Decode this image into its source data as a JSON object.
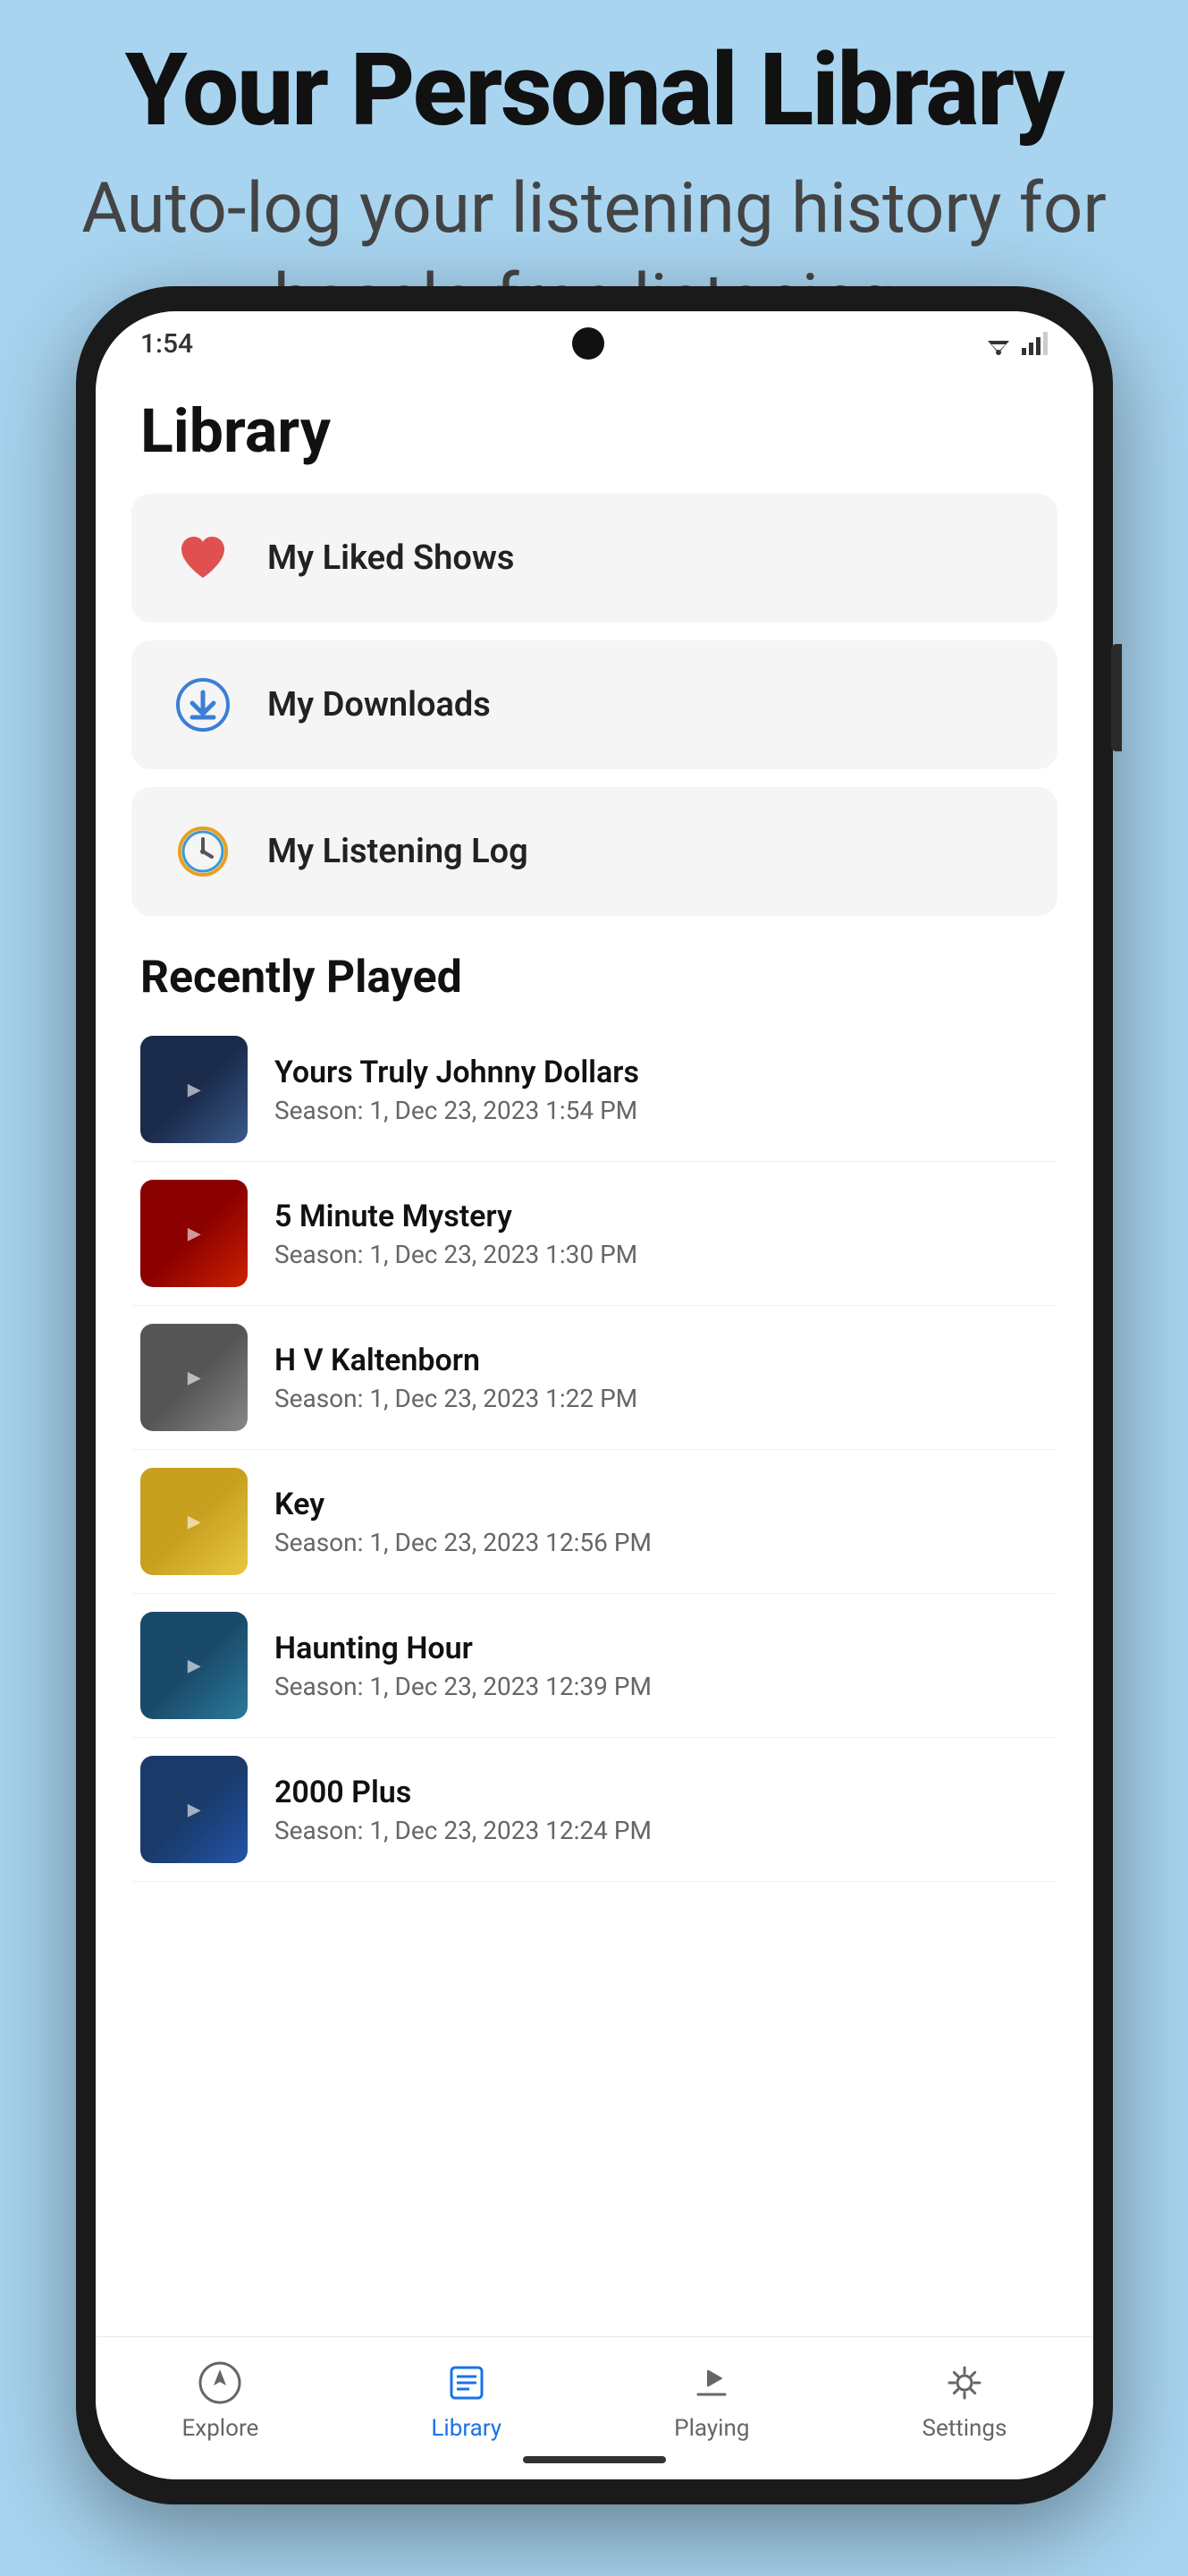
{
  "background": {
    "title": "Your Personal Library",
    "subtitle": "Auto-log your listening history  for hassle-free listening."
  },
  "status_bar": {
    "time": "1:54",
    "wifi": "▲",
    "signal": "▲"
  },
  "page_title": "Library",
  "library_items": [
    {
      "id": "liked-shows",
      "label": "My Liked Shows",
      "icon": "heart"
    },
    {
      "id": "downloads",
      "label": "My Downloads",
      "icon": "download"
    },
    {
      "id": "listening-log",
      "label": "My Listening Log",
      "icon": "clock"
    }
  ],
  "recently_played": {
    "section_title": "Recently Played",
    "items": [
      {
        "id": "johnny-dollars",
        "title": "Yours Truly Johnny Dollars",
        "meta": "Season: 1, Dec 23, 2023 1:54 PM",
        "thumb": "johnny"
      },
      {
        "id": "5-minute-mystery",
        "title": "5 Minute Mystery",
        "meta": "Season: 1, Dec 23, 2023 1:30 PM",
        "thumb": "mystery"
      },
      {
        "id": "hv-kaltenborn",
        "title": "H V Kaltenborn",
        "meta": "Season: 1, Dec 23, 2023 1:22 PM",
        "thumb": "kaltenborn"
      },
      {
        "id": "key",
        "title": "Key",
        "meta": "Season: 1, Dec 23, 2023 12:56 PM",
        "thumb": "key"
      },
      {
        "id": "haunting-hour",
        "title": "Haunting Hour",
        "meta": "Season: 1, Dec 23, 2023 12:39 PM",
        "thumb": "haunting"
      },
      {
        "id": "2000-plus",
        "title": "2000 Plus",
        "meta": "Season: 1, Dec 23, 2023 12:24 PM",
        "thumb": "2000plus"
      }
    ]
  },
  "bottom_nav": {
    "items": [
      {
        "id": "explore",
        "label": "Explore",
        "active": false
      },
      {
        "id": "library",
        "label": "Library",
        "active": true
      },
      {
        "id": "playing",
        "label": "Playing",
        "active": false
      },
      {
        "id": "settings",
        "label": "Settings",
        "active": false
      }
    ]
  }
}
